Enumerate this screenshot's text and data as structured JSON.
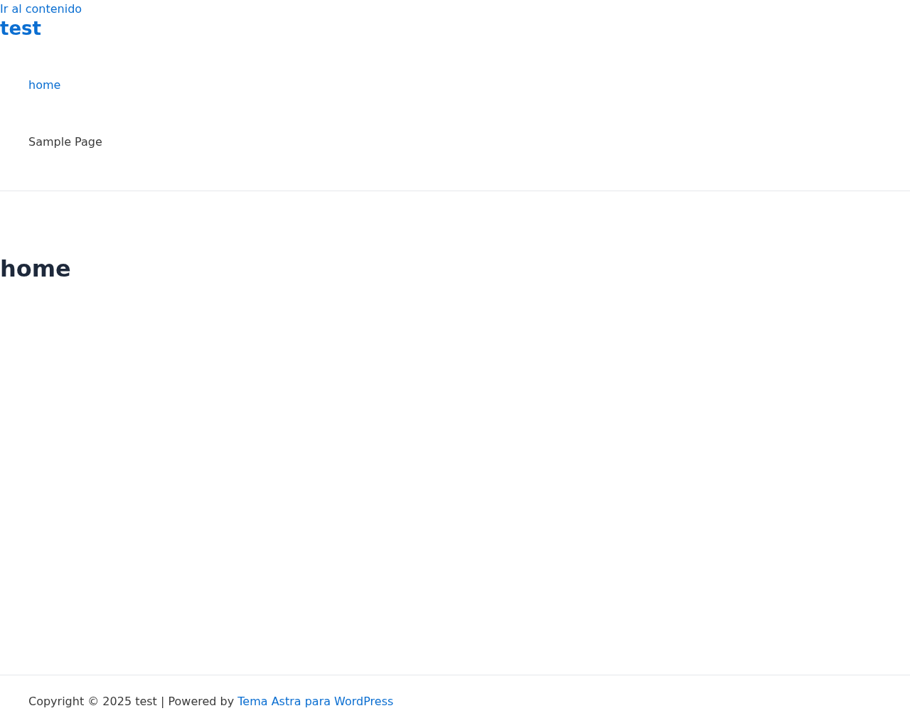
{
  "skip_link": "Ir al contenido",
  "site_title": "test",
  "nav": {
    "items": [
      {
        "label": "home",
        "selected": true
      },
      {
        "label": "Sample Page",
        "selected": false
      }
    ]
  },
  "page": {
    "title": "home"
  },
  "footer": {
    "text": "Copyright © 2025 test | Powered by ",
    "link": "Tema Astra para WordPress"
  }
}
